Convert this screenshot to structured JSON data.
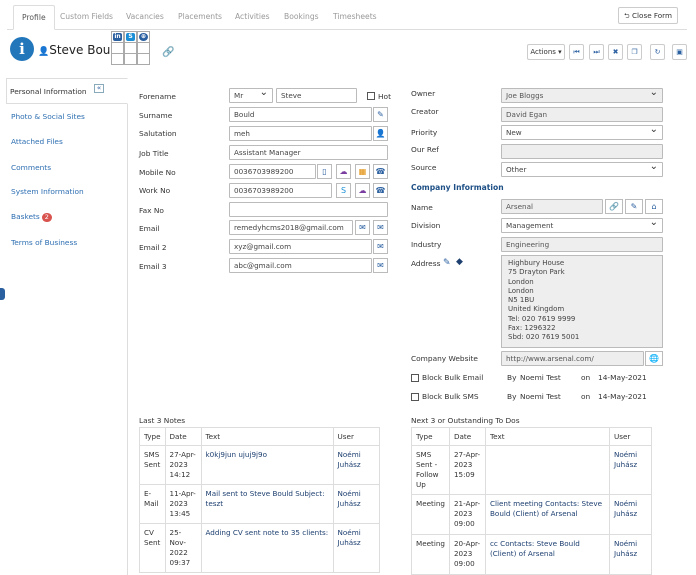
{
  "tabs": [
    "Profile",
    "Custom Fields",
    "Vacancies",
    "Placements",
    "Activities",
    "Bookings",
    "Timesheets"
  ],
  "close_form": "Close Form",
  "header": {
    "name": "Steve Bould",
    "info_icon": "i",
    "actions_label": "Actions"
  },
  "sidebar": {
    "items": [
      "Personal Information",
      "Photo & Social Sites",
      "Attached Files",
      "Comments",
      "System Information",
      "Baskets",
      "Terms of Business"
    ],
    "basket_count": "2"
  },
  "form": {
    "forename_label": "Forename",
    "title_value": "Mr",
    "forename_value": "Steve",
    "hot_label": "Hot",
    "surname_label": "Surname",
    "surname_value": "Bould",
    "salutation_label": "Salutation",
    "salutation_value": "meh",
    "jobtitle_label": "Job Title",
    "jobtitle_value": "Assistant Manager",
    "mobile_label": "Mobile No",
    "mobile_value": "0036703989200",
    "work_label": "Work No",
    "work_value": "0036703989200",
    "fax_label": "Fax No",
    "fax_value": "",
    "email_label": "Email",
    "email_value": "remedyhcms2018@gmail.com",
    "email2_label": "Email 2",
    "email2_value": "xyz@gmail.com",
    "email3_label": "Email 3",
    "email3_value": "abc@gmail.com"
  },
  "right": {
    "owner_label": "Owner",
    "owner_value": "Joe Bloggs",
    "creator_label": "Creator",
    "creator_value": "David Egan",
    "priority_label": "Priority",
    "priority_value": "New",
    "ourref_label": "Our Ref",
    "ourref_value": "",
    "source_label": "Source",
    "source_value": "Other",
    "company_header": "Company Information",
    "name_label": "Name",
    "name_value": "Arsenal",
    "division_label": "Division",
    "division_value": "Management",
    "industry_label": "Industry",
    "industry_value": "Engineering",
    "address_label": "Address",
    "address_lines": [
      "Highbury House",
      "75 Drayton Park",
      "London",
      "London",
      "N5 1BU",
      "United Kingdom",
      "Tel: 020 7619 9999",
      "Fax: 1296322",
      "Sbd: 020 7619 5001"
    ],
    "website_label": "Company Website",
    "website_value": "http://www.arsenal.com/",
    "block_email_label": "Block Bulk Email",
    "block_sms_label": "Block Bulk SMS",
    "by_label": "By",
    "by_name": "Noemi Test",
    "on_label": "on",
    "date1": "14-May-2021",
    "date2": "14-May-2021"
  },
  "notes": {
    "title": "Last 3 Notes",
    "headers": [
      "Type",
      "Date",
      "Text",
      "User"
    ],
    "rows": [
      {
        "type": "SMS Sent",
        "date": "27-Apr-2023 14:12",
        "text": "k0kj9jun ujuj9j9o",
        "user": "Noémi Juhász"
      },
      {
        "type": "E-Mail",
        "date": "11-Apr-2023 13:45",
        "text": "Mail sent to Steve Bould Subject: teszt",
        "user": "Noémi Juhász"
      },
      {
        "type": "CV Sent",
        "date": "25-Nov-2022 09:37",
        "text": "Adding CV sent note to 35 clients:",
        "user": "Noémi Juhász"
      }
    ]
  },
  "todos": {
    "title": "Next 3 or Outstanding To Dos",
    "headers": [
      "Type",
      "Date",
      "Text",
      "User"
    ],
    "rows": [
      {
        "type": "SMS Sent - Follow Up",
        "date": "27-Apr-2023 15:09",
        "text": "",
        "user": "Noémi Juhász"
      },
      {
        "type": "Meeting",
        "date": "21-Apr-2023 09:00",
        "text": "Client meeting Contacts: Steve Bould (Client) of Arsenal",
        "user": "Noémi Juhász"
      },
      {
        "type": "Meeting",
        "date": "20-Apr-2023 09:00",
        "text": "cc Contacts: Steve Bould (Client) of Arsenal",
        "user": "Noémi Juhász"
      }
    ]
  }
}
